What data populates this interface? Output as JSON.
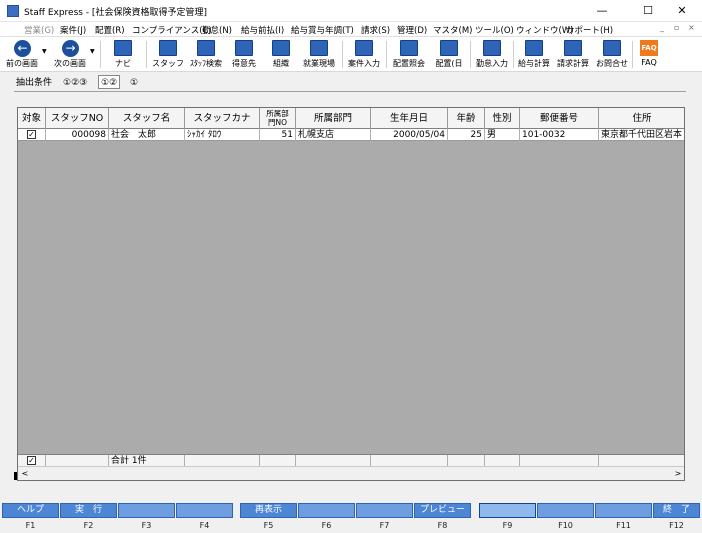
{
  "window": {
    "title": "Staff Express - [社会保険資格取得予定管理]",
    "min": "—",
    "max": "☐",
    "close": "✕"
  },
  "menu": {
    "items": [
      "営業(G)",
      "案件(J)",
      "配置(R)",
      "コンプライアンス(C)",
      "勤怠(N)",
      "給与前払(I)",
      "給与賞与年調(T)",
      "請求(S)",
      "管理(D)",
      "マスタ(M)",
      "ツール(O)",
      "ウィンドウ(W)",
      "サポート(H)"
    ],
    "mdi": [
      "_",
      "▫",
      "×"
    ]
  },
  "toolbar": {
    "prev": "前の画面",
    "next": "次の画面",
    "navi": "ナビ",
    "staff": "スタッフ",
    "staff_search": "ｽﾀｯﾌ検索",
    "client": "得意先",
    "org": "組織",
    "workplace": "就業現場",
    "case_input": "案件入力",
    "assign_inquiry": "配置照会",
    "assign_day": "配置(日",
    "attendance_input": "勤怠入力",
    "salary_calc": "給与計算",
    "billing_calc": "請求計算",
    "contact": "お問合せ",
    "faq": "FAQ",
    "faq_icon": "FAQ",
    "prev_icon": "←",
    "next_icon": "→",
    "dropdown": "▼"
  },
  "tabs": [
    "抽出条件",
    "①②③",
    "①②",
    "①"
  ],
  "grid": {
    "headers": [
      "対象",
      "スタッフNO",
      "スタッフ名",
      "スタッフカナ",
      "所属部\n門NO",
      "所属部門",
      "生年月日",
      "年齢",
      "性別",
      "郵便番号",
      "住所"
    ],
    "rows": [
      {
        "check": "✓",
        "staff_no": "000098",
        "staff_name": "社会　太郎",
        "staff_kana": "ｼｬｶｲ ﾀﾛｳ",
        "dept_no": "51",
        "dept": "札幌支店",
        "birth": "2000/05/04",
        "age": "25",
        "sex": "男",
        "zip": "101-0032",
        "address": "東京都千代田区岩本"
      }
    ],
    "footer": {
      "check": "✓",
      "total": "合計 1件"
    },
    "scroll_left": "<",
    "scroll_right": ">"
  },
  "fkeys": [
    {
      "label": "ヘルプ",
      "num": "F1"
    },
    {
      "label": "実　行",
      "num": "F2"
    },
    {
      "label": "",
      "num": "F3"
    },
    {
      "label": "",
      "num": "F4"
    },
    {
      "label": "再表示",
      "num": "F5"
    },
    {
      "label": "",
      "num": "F6"
    },
    {
      "label": "",
      "num": "F7"
    },
    {
      "label": "プレビュー",
      "num": "F8"
    },
    {
      "label": "",
      "num": "F9"
    },
    {
      "label": "",
      "num": "F10"
    },
    {
      "label": "",
      "num": "F11"
    },
    {
      "label": "終　了",
      "num": "F12"
    }
  ]
}
